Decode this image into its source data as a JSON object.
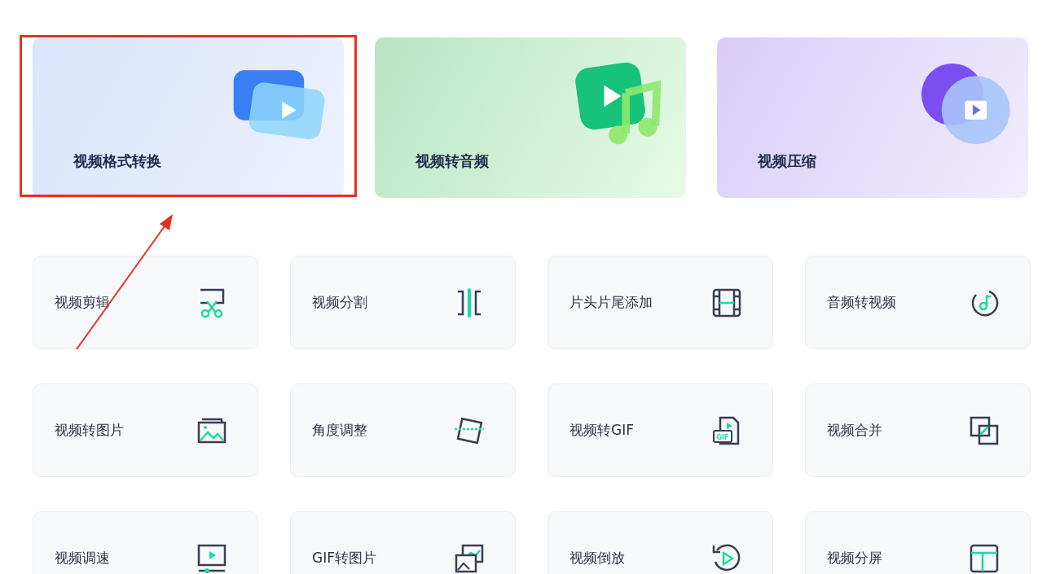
{
  "feature_cards": [
    {
      "label": "视频格式转换",
      "kind": "convert",
      "highlighted": true
    },
    {
      "label": "视频转音频",
      "kind": "audio",
      "highlighted": false
    },
    {
      "label": "视频压缩",
      "kind": "compress",
      "highlighted": false
    }
  ],
  "tools": [
    {
      "label": "视频剪辑",
      "kind": "cut"
    },
    {
      "label": "视频分割",
      "kind": "split"
    },
    {
      "label": "片头片尾添加",
      "kind": "film"
    },
    {
      "label": "音频转视频",
      "kind": "music"
    },
    {
      "label": "视频转图片",
      "kind": "image"
    },
    {
      "label": "角度调整",
      "kind": "rotate"
    },
    {
      "label": "视频转GIF",
      "kind": "gif",
      "icon_text": "GIF"
    },
    {
      "label": "视频合并",
      "kind": "merge"
    },
    {
      "label": "视频调速",
      "kind": "speed"
    },
    {
      "label": "GIF转图片",
      "kind": "images"
    },
    {
      "label": "视频倒放",
      "kind": "reverse"
    },
    {
      "label": "视频分屏",
      "kind": "layout"
    }
  ]
}
